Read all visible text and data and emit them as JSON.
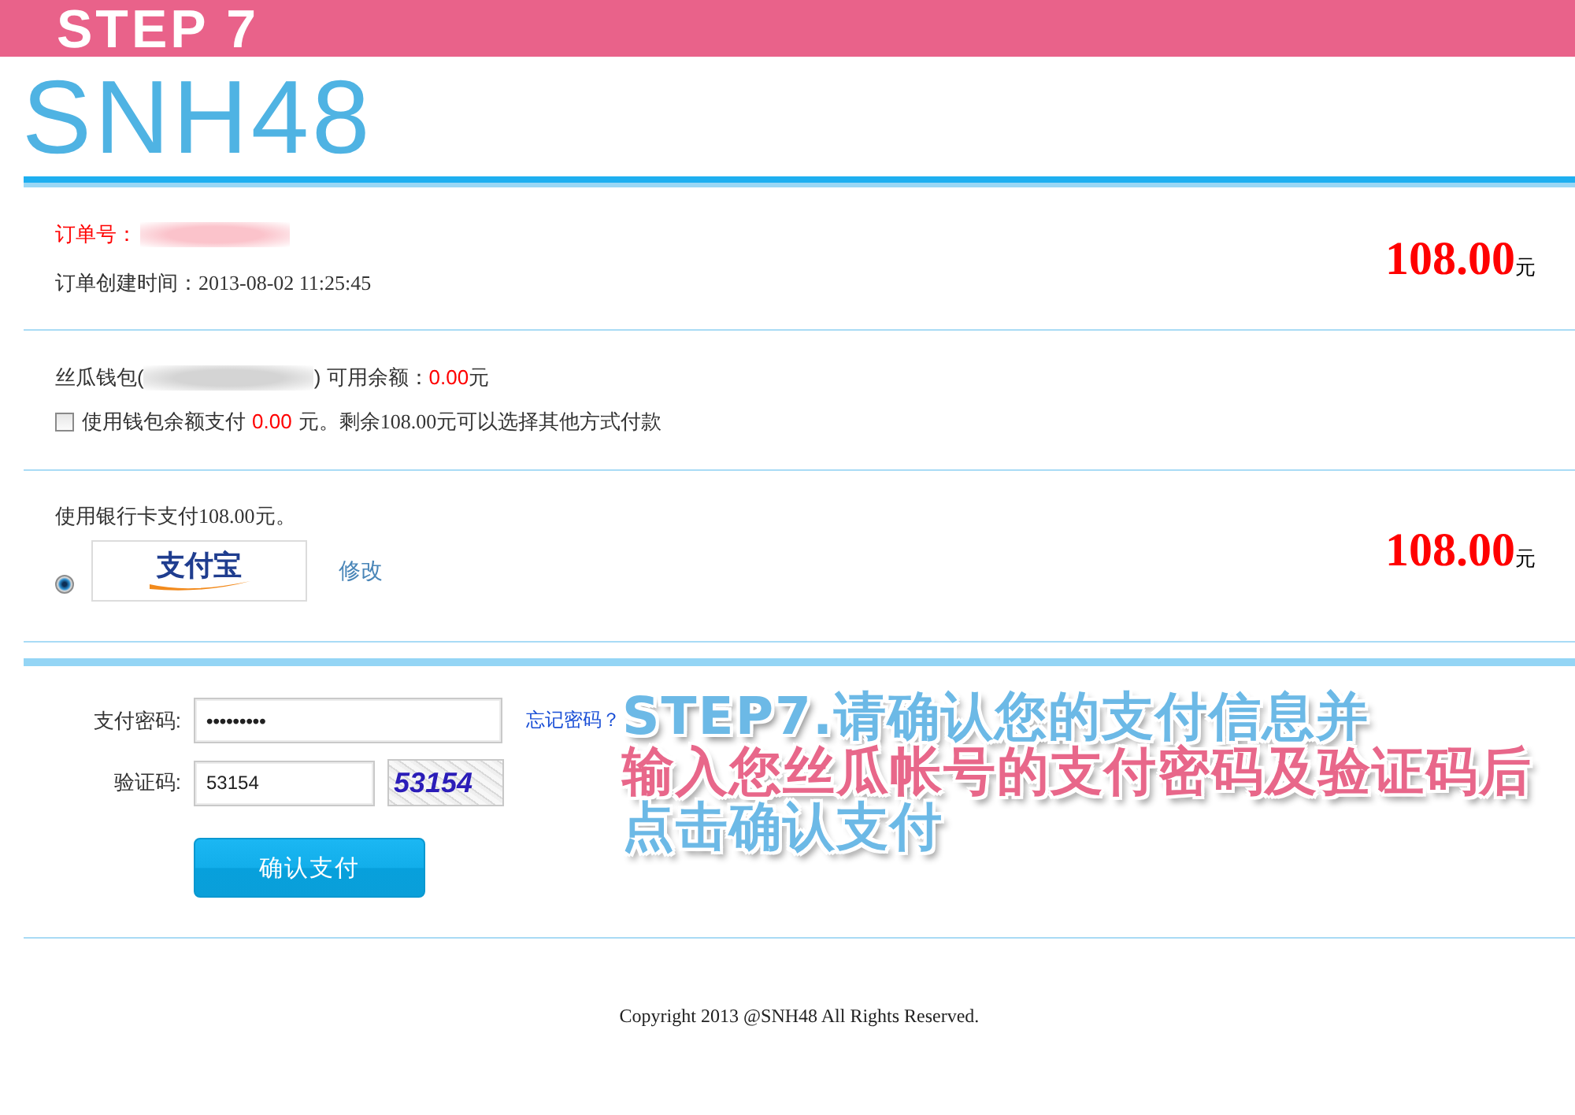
{
  "banner": {
    "title": "STEP 7"
  },
  "header": {
    "logo_text": "SNH48"
  },
  "order": {
    "number_label": "订单号：",
    "created": "订单创建时间：2013-08-02 11:25:45",
    "amount": "108.00",
    "currency": "元"
  },
  "wallet": {
    "name": "丝瓜钱包(",
    "balance_label": ") 可用余额：",
    "balance": "0.00",
    "balance_unit": "元",
    "use_balance": {
      "checked": false,
      "label": "使用钱包余额支付",
      "amount": "0.00",
      "note": "元。剩余108.00元可以选择其他方式付款"
    }
  },
  "bank": {
    "label": "使用银行卡支付108.00元。",
    "method": {
      "selected": true,
      "logo_text": "支付宝"
    },
    "change_link": "修改",
    "amount": "108.00",
    "currency": "元"
  },
  "form": {
    "fields": [
      {
        "kind": "password",
        "label": "支付密码:",
        "value": "•••••••••",
        "link": "忘记密码？"
      },
      {
        "kind": "captcha",
        "label": "验证码:",
        "value": "53154",
        "captcha_text": "53154"
      }
    ],
    "submit": "确认支付"
  },
  "footer": {
    "copyright": "Copyright 2013 @SNH48 All Rights Reserved."
  },
  "annotation": {
    "lines": [
      {
        "text": "STEP7.请确认您的支付信息并",
        "color": "#6cb9e6"
      },
      {
        "text": "输入您丝瓜帐号的支付密码及验证码后",
        "color": "#e8678a"
      },
      {
        "text": "点击确认支付",
        "color": "#6cb9e6"
      }
    ]
  }
}
